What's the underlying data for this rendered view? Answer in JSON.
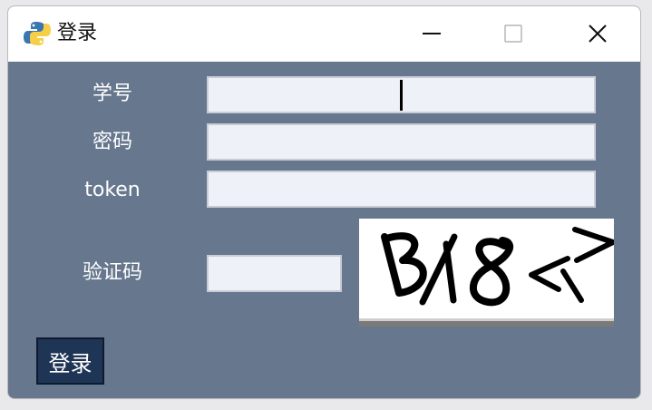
{
  "window": {
    "title": "登录",
    "app_icon": "python-icon"
  },
  "form": {
    "student_id": {
      "label": "学号",
      "value": ""
    },
    "password": {
      "label": "密码",
      "value": ""
    },
    "token": {
      "label": "token",
      "value": ""
    },
    "captcha": {
      "label": "验证码",
      "value": "",
      "image_text": "B18<>"
    }
  },
  "buttons": {
    "login_label": "登录"
  },
  "colors": {
    "background": "#66778e",
    "input_bg": "#eef2f8",
    "button_bg": "#1f3556"
  }
}
